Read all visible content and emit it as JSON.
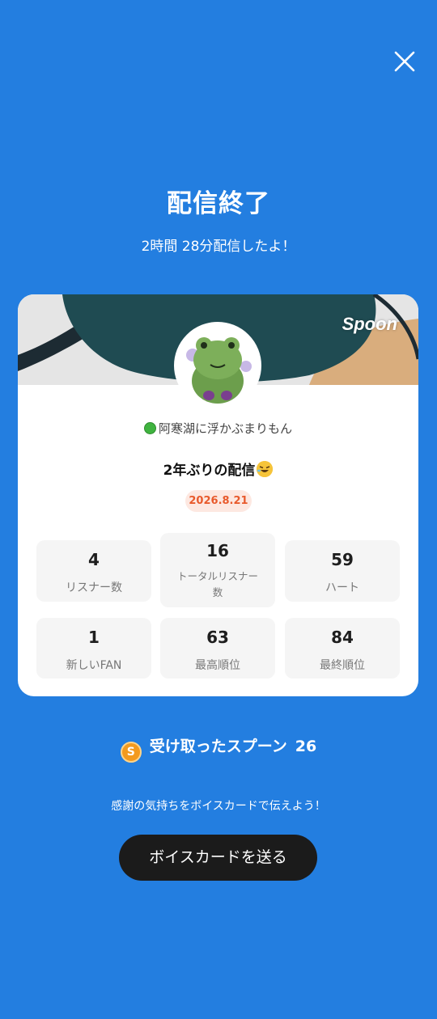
{
  "header": {
    "title": "配信終了",
    "subtitle": "2時間 28分配信したよ！"
  },
  "card": {
    "brand": "Spoon",
    "nickname": "阿寒湖に浮かぶまりもん",
    "live_title": "2年ぶりの配信",
    "date": "2026.8.21",
    "stats": [
      {
        "value": "4",
        "label": "リスナー数"
      },
      {
        "value": "16",
        "label": "トータルリスナー数"
      },
      {
        "value": "59",
        "label": "ハート"
      },
      {
        "value": "1",
        "label": "新しいFAN"
      },
      {
        "value": "63",
        "label": "最高順位"
      },
      {
        "value": "84",
        "label": "最終順位"
      }
    ]
  },
  "spoons": {
    "coin_letter": "S",
    "label": "受け取ったスプーン",
    "count": "26"
  },
  "footer": {
    "thanks_text": "感謝の気持ちをボイスカードで伝えよう！",
    "send_button": "ボイスカードを送る"
  },
  "icons": {
    "close": "close-icon",
    "status_dot": "green-circle-icon",
    "emoji": "rolling-laughing-emoji-icon",
    "coin": "spoon-coin-icon"
  },
  "colors": {
    "background": "#237ee0",
    "date_badge_text": "#e85a2c",
    "date_badge_bg": "#fde8e1",
    "button": "#1b1b1b",
    "coin": "#f39a1f"
  }
}
